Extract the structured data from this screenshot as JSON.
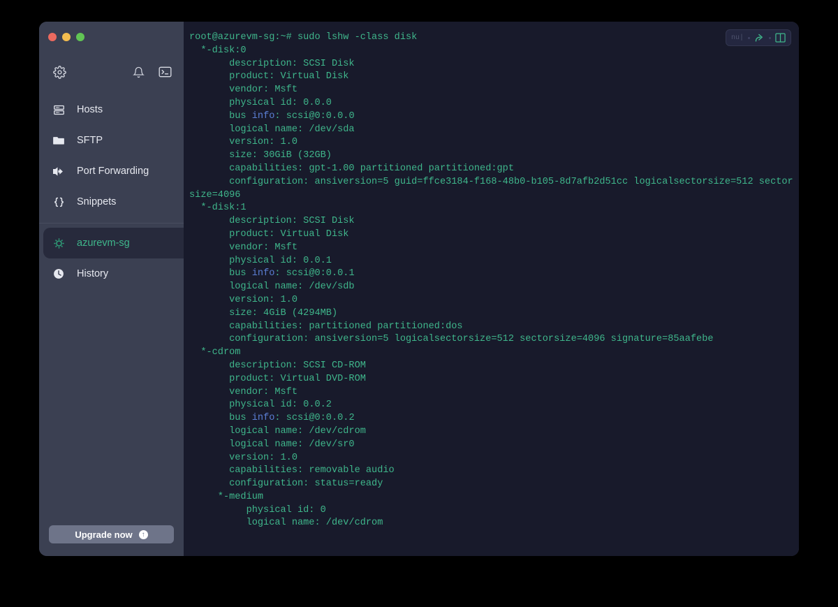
{
  "window": {
    "traffic_lights": [
      {
        "name": "close",
        "color": "#ec6a5f"
      },
      {
        "name": "minimize",
        "color": "#f4bd4f"
      },
      {
        "name": "maximize",
        "color": "#61c554"
      }
    ]
  },
  "sidebar": {
    "toolbar": [
      {
        "name": "settings-icon",
        "label": "Settings"
      },
      {
        "name": "notifications-icon",
        "label": "Notifications"
      },
      {
        "name": "terminal-icon",
        "label": "Terminal"
      }
    ],
    "items": [
      {
        "label": "Hosts",
        "icon": "server-rack-icon",
        "active": false
      },
      {
        "label": "SFTP",
        "icon": "folder-icon",
        "active": false
      },
      {
        "label": "Port Forwarding",
        "icon": "port-forwarding-icon",
        "active": false
      },
      {
        "label": "Snippets",
        "icon": "braces-icon",
        "active": false
      },
      {
        "label": "azurevm-sg",
        "icon": "session-icon",
        "active": true
      },
      {
        "label": "History",
        "icon": "clock-icon",
        "active": false
      }
    ],
    "upgrade": {
      "label": "Upgrade now",
      "icon_glyph": "↑"
    }
  },
  "terminal": {
    "controls": {
      "shell_badge": "nu|",
      "share_icon": "share-arrow-icon",
      "split_icon": "split-pane-icon",
      "accent_color": "#3fb68b"
    },
    "prompt": "root@azurevm-sg:~#",
    "command": "sudo lshw -class disk",
    "lines": [
      {
        "text": "root@azurevm-sg:~# sudo lshw -class disk"
      },
      {
        "text": "  *-disk:0"
      },
      {
        "text": "       description: SCSI Disk"
      },
      {
        "text": "       product: Virtual Disk"
      },
      {
        "text": "       vendor: Msft"
      },
      {
        "text": "       physical id: 0.0.0"
      },
      {
        "pre": "       bus ",
        "blue": "info",
        "post": ": scsi@0:0.0.0"
      },
      {
        "text": "       logical name: /dev/sda"
      },
      {
        "text": "       version: 1.0"
      },
      {
        "text": "       size: 30GiB (32GB)"
      },
      {
        "text": "       capabilities: gpt-1.00 partitioned partitioned:gpt"
      },
      {
        "text": "       configuration: ansiversion=5 guid=ffce3184-f168-48b0-b105-8d7afb2d51cc logicalsectorsize=512 sectorsize=4096"
      },
      {
        "text": "  *-disk:1"
      },
      {
        "text": "       description: SCSI Disk"
      },
      {
        "text": "       product: Virtual Disk"
      },
      {
        "text": "       vendor: Msft"
      },
      {
        "text": "       physical id: 0.0.1"
      },
      {
        "pre": "       bus ",
        "blue": "info",
        "post": ": scsi@0:0.0.1"
      },
      {
        "text": "       logical name: /dev/sdb"
      },
      {
        "text": "       version: 1.0"
      },
      {
        "text": "       size: 4GiB (4294MB)"
      },
      {
        "text": "       capabilities: partitioned partitioned:dos"
      },
      {
        "text": "       configuration: ansiversion=5 logicalsectorsize=512 sectorsize=4096 signature=85aafebe"
      },
      {
        "text": "  *-cdrom"
      },
      {
        "text": "       description: SCSI CD-ROM"
      },
      {
        "text": "       product: Virtual DVD-ROM"
      },
      {
        "text": "       vendor: Msft"
      },
      {
        "text": "       physical id: 0.0.2"
      },
      {
        "pre": "       bus ",
        "blue": "info",
        "post": ": scsi@0:0.0.2"
      },
      {
        "text": "       logical name: /dev/cdrom"
      },
      {
        "text": "       logical name: /dev/sr0"
      },
      {
        "text": "       version: 1.0"
      },
      {
        "text": "       capabilities: removable audio"
      },
      {
        "text": "       configuration: status=ready"
      },
      {
        "text": "     *-medium"
      },
      {
        "text": "          physical id: 0"
      },
      {
        "text": "          logical name: /dev/cdrom"
      }
    ]
  }
}
